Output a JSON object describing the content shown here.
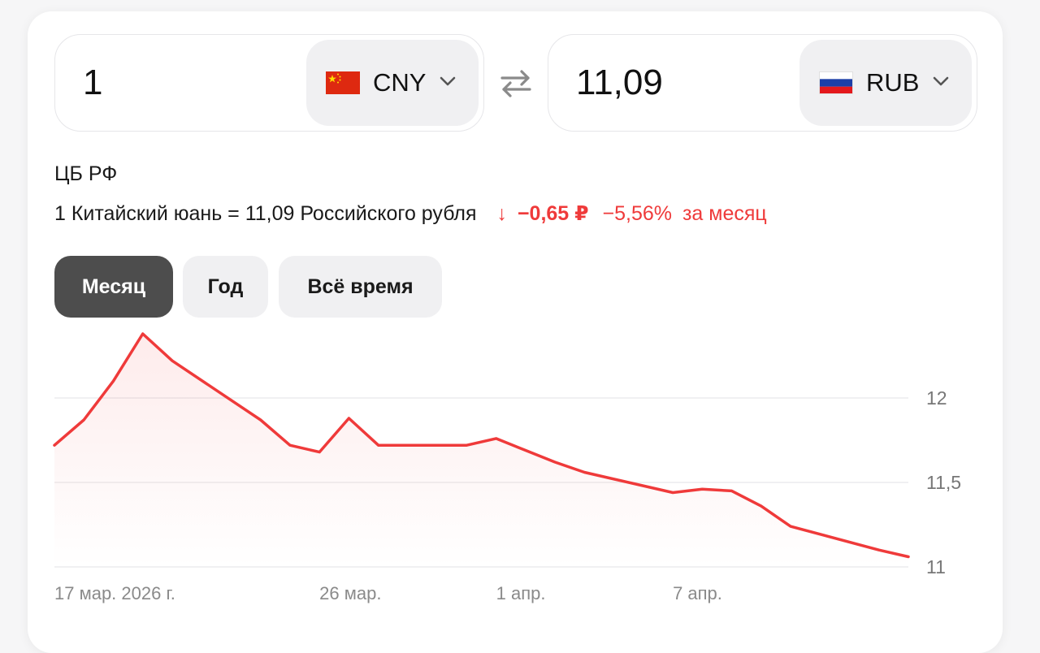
{
  "converter": {
    "from": {
      "amount": "1",
      "currency": "CNY",
      "flag": "china-flag-icon"
    },
    "to": {
      "amount": "11,09",
      "currency": "RUB",
      "flag": "russia-flag-icon"
    },
    "swap_icon": "swap-arrows-icon"
  },
  "rate_info": {
    "source": "ЦБ РФ",
    "description": "1 Китайский юань = 11,09 Российского рубля",
    "change_arrow": "↓",
    "change_abs": "−0,65 ₽",
    "change_pct": "−5,56%",
    "period": "за месяц"
  },
  "tabs": [
    {
      "label": "Месяц",
      "active": true
    },
    {
      "label": "Год",
      "active": false
    },
    {
      "label": "Всё время",
      "active": false
    }
  ],
  "colors": {
    "line": "#ef3a3a",
    "negative": "#ef3a3a",
    "active_tab": "#4d4d4d",
    "tab_bg": "#f0f0f2"
  },
  "chart_data": {
    "type": "line",
    "title": "",
    "xlabel": "",
    "ylabel": "",
    "x": [
      "2026-03-17",
      "2026-03-18",
      "2026-03-19",
      "2026-03-20",
      "2026-03-21",
      "2026-03-24",
      "2026-03-25",
      "2026-03-26",
      "2026-03-27",
      "2026-03-28",
      "2026-03-31",
      "2026-04-01",
      "2026-04-02",
      "2026-04-03",
      "2026-04-04",
      "2026-04-07",
      "2026-04-08",
      "2026-04-09",
      "2026-04-10",
      "2026-04-11",
      "2026-04-14",
      "2026-04-15"
    ],
    "series": [
      {
        "values": [
          11.72,
          11.87,
          12.1,
          12.38,
          12.22,
          11.87,
          11.72,
          11.68,
          11.88,
          11.72,
          11.72,
          11.76,
          11.69,
          11.62,
          11.56,
          11.44,
          11.46,
          11.45,
          11.36,
          11.24,
          11.1,
          11.06
        ]
      }
    ],
    "y_ticks": [
      "12",
      "11,5",
      "11"
    ],
    "y_tick_values": [
      12,
      11.5,
      11
    ],
    "ylim": [
      11,
      12.4
    ],
    "x_tick_labels": [
      {
        "label": "17 мар. 2026 г.",
        "date": "2026-03-17"
      },
      {
        "label": "26 мар.",
        "date": "2026-03-26"
      },
      {
        "label": "1 апр.",
        "date": "2026-04-01"
      },
      {
        "label": "7 апр.",
        "date": "2026-04-07"
      }
    ],
    "grid": true,
    "legend": "none"
  }
}
